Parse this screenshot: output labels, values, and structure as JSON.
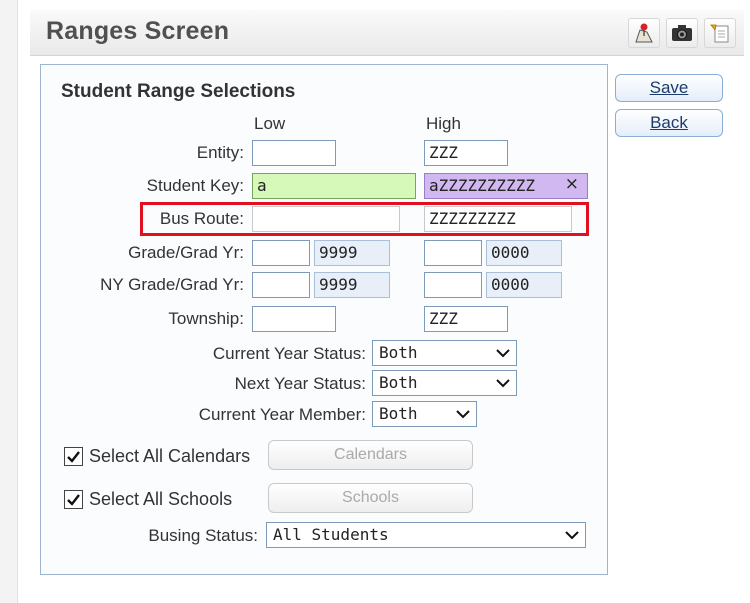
{
  "header": {
    "title": "Ranges Screen",
    "icons": [
      "map-pin-icon",
      "camera-icon",
      "notes-icon"
    ]
  },
  "panel": {
    "title": "Student Range Selections",
    "low_label": "Low",
    "high_label": "High",
    "rows": {
      "entity": {
        "label": "Entity:",
        "low": "",
        "high": "ZZZ"
      },
      "student_key": {
        "label": "Student Key:",
        "low": "a",
        "high": "aZZZZZZZZZZ"
      },
      "bus_route": {
        "label": "Bus Route:",
        "low": "",
        "high": "ZZZZZZZZZ"
      },
      "grade_grad_yr": {
        "label": "Grade/Grad Yr:",
        "low_grade": "",
        "low_year": "9999",
        "high_grade": "",
        "high_year": "0000"
      },
      "ny_grade_grad_yr": {
        "label": "NY Grade/Grad Yr:",
        "low_grade": "",
        "low_year": "9999",
        "high_grade": "",
        "high_year": "0000"
      },
      "township": {
        "label": "Township:",
        "low": "",
        "high": "ZZZ"
      }
    },
    "current_year_status": {
      "label": "Current Year Status:",
      "value": "Both"
    },
    "next_year_status": {
      "label": "Next Year Status:",
      "value": "Both"
    },
    "current_year_member": {
      "label": "Current Year Member:",
      "value": "Both"
    },
    "select_all_calendars": {
      "label": "Select All Calendars",
      "checked": true,
      "button": "Calendars"
    },
    "select_all_schools": {
      "label": "Select All Schools",
      "checked": true,
      "button": "Schools"
    },
    "busing_status": {
      "label": "Busing Status:",
      "value": "All Students"
    },
    "clear_glyph": "×",
    "highlight_color": "#e01020"
  },
  "actions": {
    "save": "Save",
    "back": "Back"
  }
}
